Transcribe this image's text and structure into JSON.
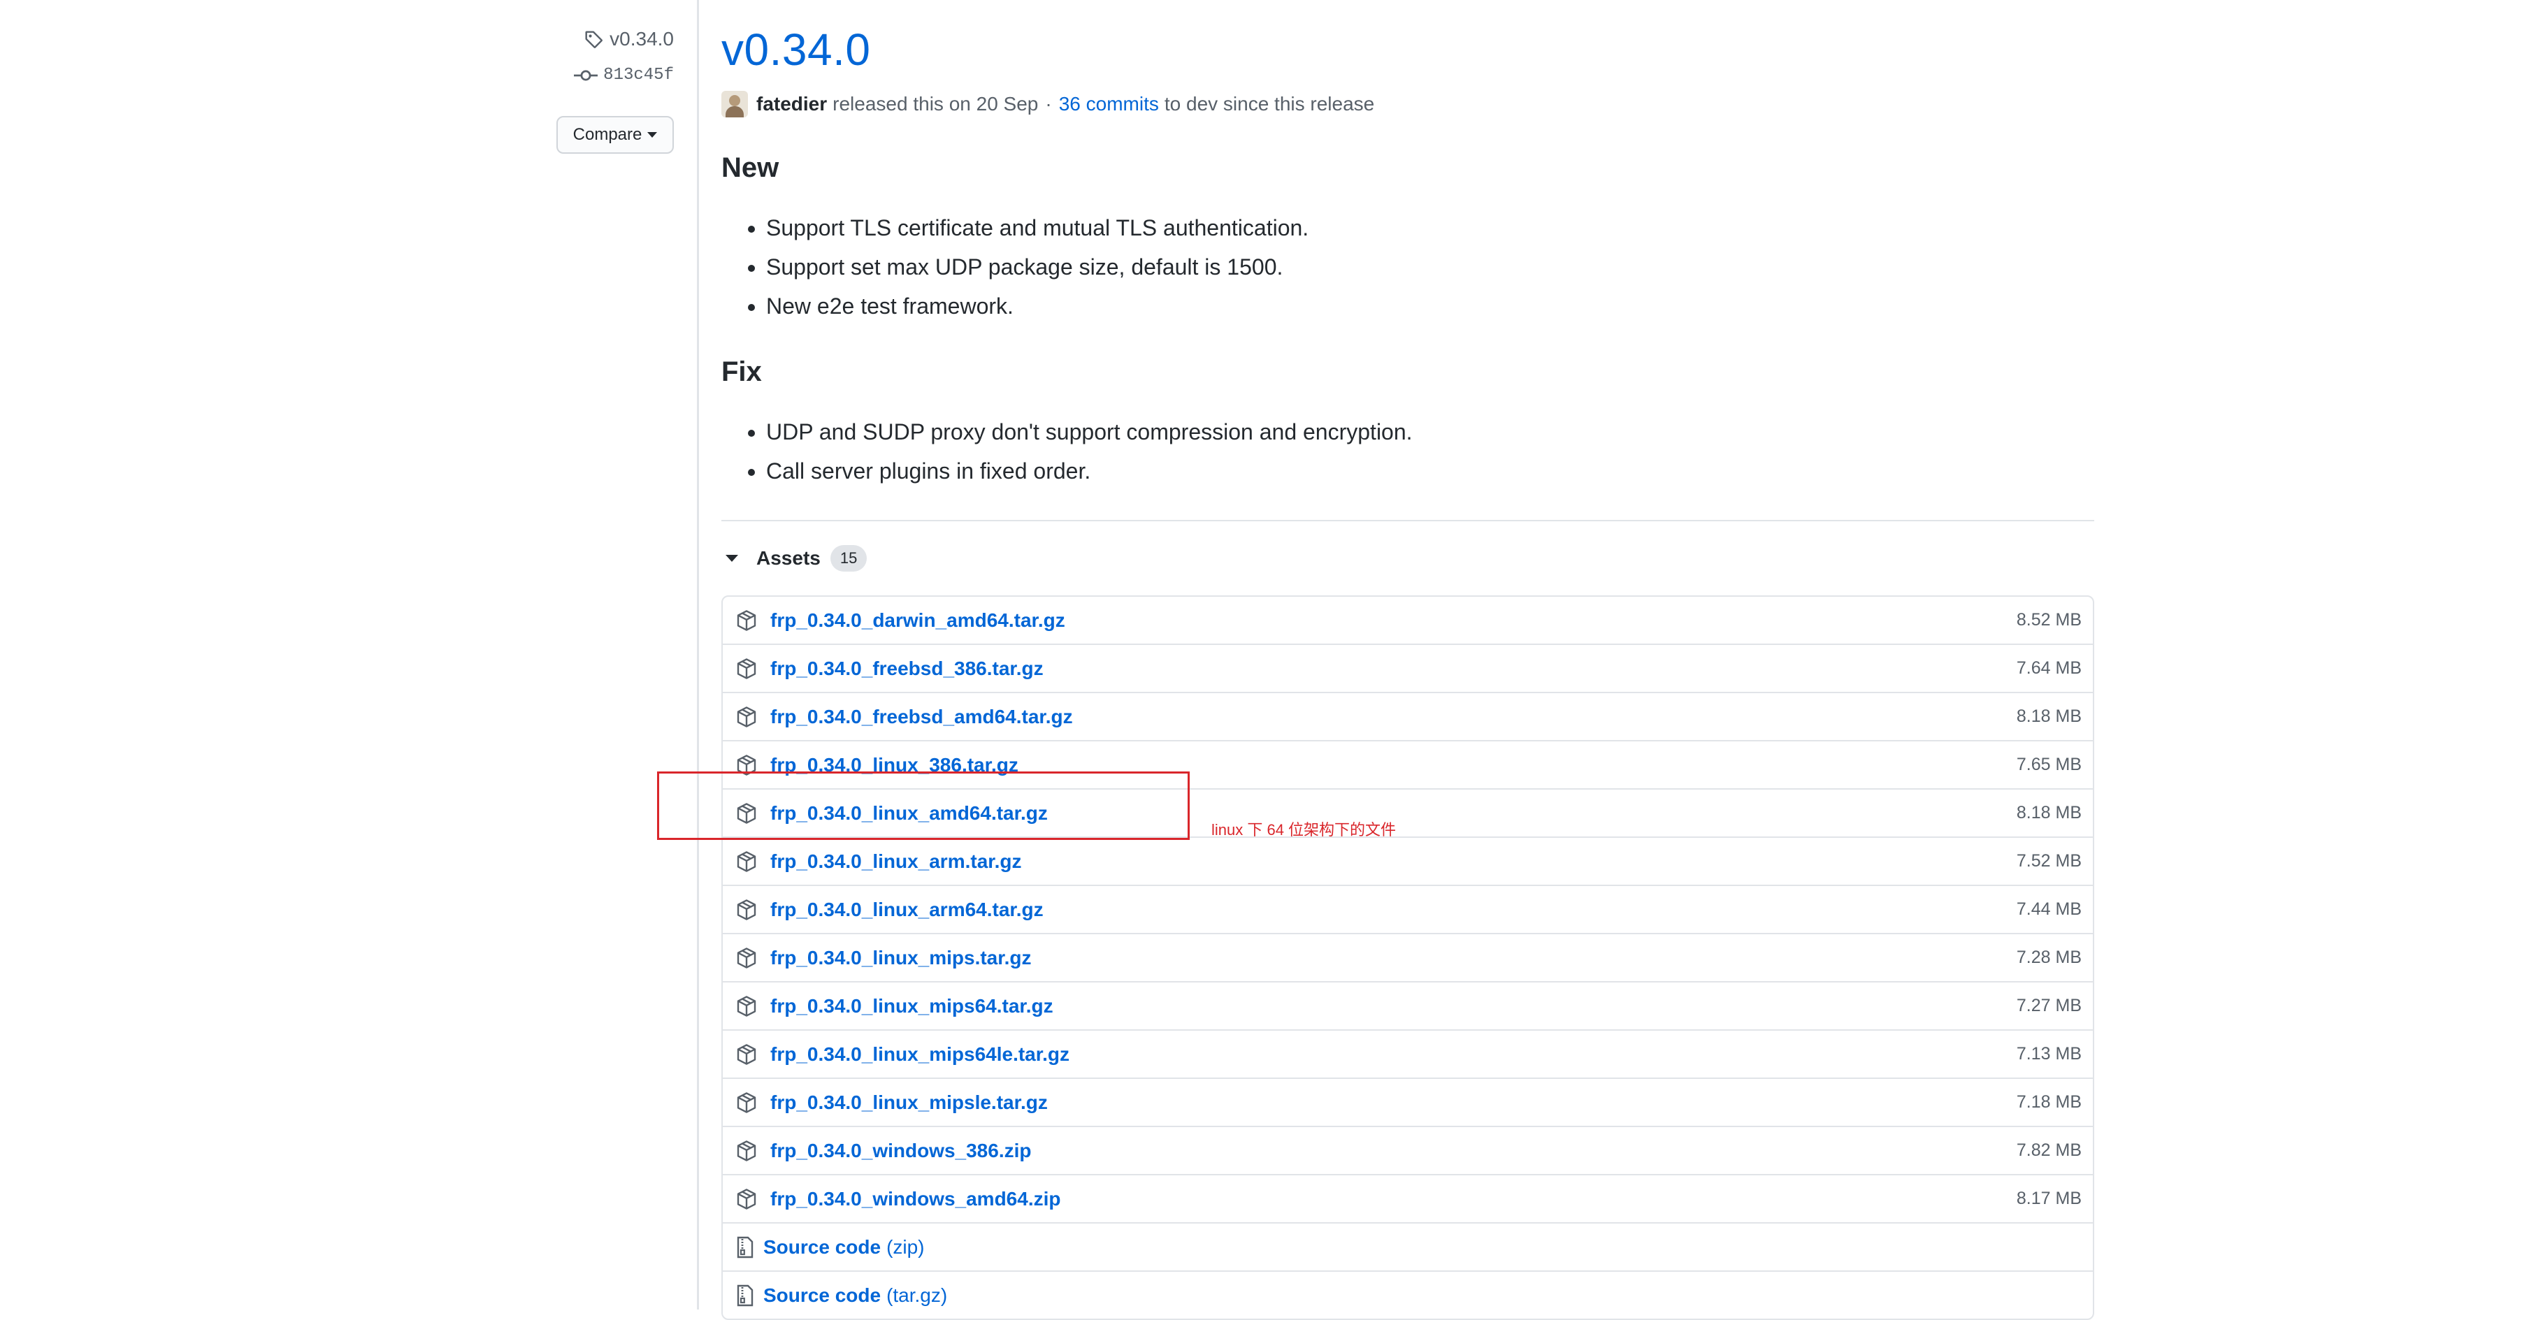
{
  "sidebar": {
    "tag": "v0.34.0",
    "commit": "813c45f",
    "compare_label": "Compare"
  },
  "release": {
    "title": "v0.34.0",
    "author": "fatedier",
    "released_text": "released this on 20 Sep",
    "separator": "·",
    "commits_link": "36 commits",
    "commits_suffix": "to dev since this release"
  },
  "sections": [
    {
      "heading": "New",
      "items": [
        "Support TLS certificate and mutual TLS authentication.",
        "Support set max UDP package size, default is 1500.",
        "New e2e test framework."
      ]
    },
    {
      "heading": "Fix",
      "items": [
        "UDP and SUDP proxy don't support compression and encryption.",
        "Call server plugins in fixed order."
      ]
    }
  ],
  "assets": {
    "label": "Assets",
    "count": "15",
    "files": [
      {
        "name": "frp_0.34.0_darwin_amd64.tar.gz",
        "size": "8.52 MB"
      },
      {
        "name": "frp_0.34.0_freebsd_386.tar.gz",
        "size": "7.64 MB"
      },
      {
        "name": "frp_0.34.0_freebsd_amd64.tar.gz",
        "size": "8.18 MB"
      },
      {
        "name": "frp_0.34.0_linux_386.tar.gz",
        "size": "7.65 MB"
      },
      {
        "name": "frp_0.34.0_linux_amd64.tar.gz",
        "size": "8.18 MB"
      },
      {
        "name": "frp_0.34.0_linux_arm.tar.gz",
        "size": "7.52 MB"
      },
      {
        "name": "frp_0.34.0_linux_arm64.tar.gz",
        "size": "7.44 MB"
      },
      {
        "name": "frp_0.34.0_linux_mips.tar.gz",
        "size": "7.28 MB"
      },
      {
        "name": "frp_0.34.0_linux_mips64.tar.gz",
        "size": "7.27 MB"
      },
      {
        "name": "frp_0.34.0_linux_mips64le.tar.gz",
        "size": "7.13 MB"
      },
      {
        "name": "frp_0.34.0_linux_mipsle.tar.gz",
        "size": "7.18 MB"
      },
      {
        "name": "frp_0.34.0_windows_386.zip",
        "size": "7.82 MB"
      },
      {
        "name": "frp_0.34.0_windows_amd64.zip",
        "size": "8.17 MB"
      }
    ],
    "source": [
      {
        "name": "Source code",
        "ext": "(zip)"
      },
      {
        "name": "Source code",
        "ext": "(tar.gz)"
      }
    ]
  },
  "annotation": {
    "text": "linux 下 64 位架构下的文件",
    "color": "#d9262b"
  },
  "icons": {
    "tag": "tag-icon",
    "commit": "git-commit-icon",
    "package": "package-icon",
    "source": "file-zip-icon",
    "caret": "triangle-down-icon"
  },
  "colors": {
    "link": "#0366d6",
    "text": "#24292e",
    "muted": "#586069",
    "border": "#e1e4e8"
  }
}
